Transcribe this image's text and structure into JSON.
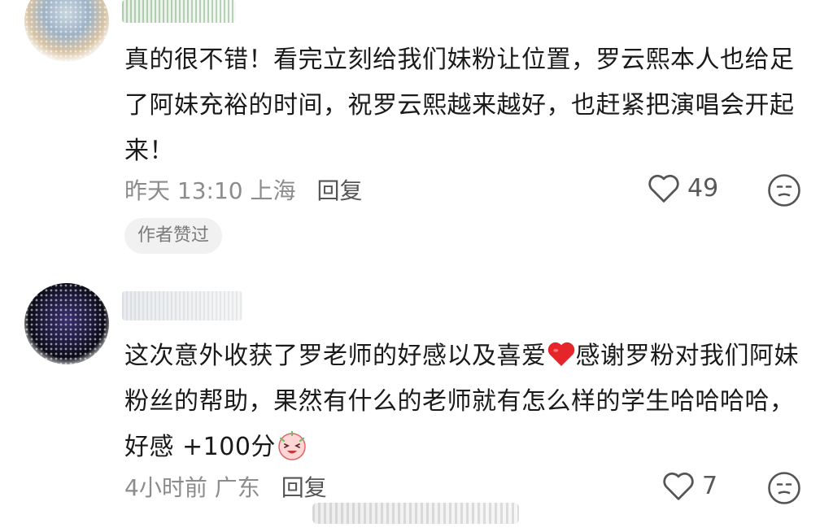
{
  "comments": [
    {
      "text": "真的很不错！看完立刻给我们妹粉让位置，罗云熙本人也给足了阿妹充裕的时间，祝罗云熙越来越好，也赶紧把演唱会开起来！",
      "time": "昨天 13:10 上海",
      "reply_label": "回复",
      "likes": "49",
      "badge": "作者赞过"
    },
    {
      "text_before_heart": "这次意外收获了罗老师的好感以及喜爱",
      "text_after_heart": "感谢罗粉对我们阿妹粉丝的帮助，果然有什么的老师就有怎么样的学生哈哈哈哈，好感 +100分",
      "time": "4小时前 广东",
      "reply_label": "回复",
      "likes": "7"
    }
  ],
  "icons": {
    "like": "heart-outline-icon",
    "dislike": "neutral-face-icon",
    "emoji_heart": "red-heart-emoji",
    "emoji_sticker": "laughing-face-sticker"
  },
  "colors": {
    "text": "#1a1a1a",
    "meta": "#8c8c8c",
    "badge_bg": "#f1f1f1",
    "heart_emoji": "#e5252a"
  }
}
